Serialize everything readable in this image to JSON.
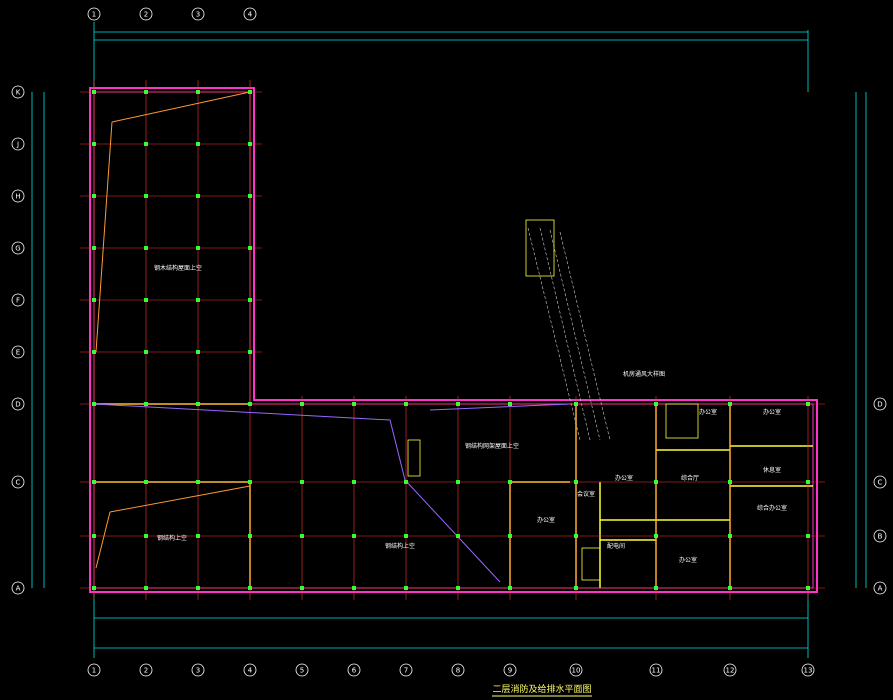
{
  "drawing": {
    "title": "二层消防及给排水平面图",
    "rooms": [
      {
        "key": "r1",
        "label": "钢木结构屋面上空"
      },
      {
        "key": "r2",
        "label": "钢结构上空"
      },
      {
        "key": "r3",
        "label": "钢结构上空"
      },
      {
        "key": "r4",
        "label": "钢结构网架屋面上空"
      },
      {
        "key": "r5",
        "label": "办公室"
      },
      {
        "key": "r6",
        "label": "会议室"
      },
      {
        "key": "r7",
        "label": "办公室"
      },
      {
        "key": "r8",
        "label": "综合厅"
      },
      {
        "key": "r9",
        "label": "办公室"
      },
      {
        "key": "r10",
        "label": "办公室"
      },
      {
        "key": "r11",
        "label": "办公室"
      },
      {
        "key": "r12",
        "label": "休息室"
      },
      {
        "key": "r13",
        "label": "综合办公室"
      },
      {
        "key": "r14",
        "label": "配电间"
      },
      {
        "key": "r15",
        "label": "机房通风大样图"
      }
    ],
    "axes_top": [
      "1",
      "2",
      "3",
      "4"
    ],
    "axes_bottom": [
      "1",
      "2",
      "3",
      "4",
      "5",
      "6",
      "7",
      "8",
      "9",
      "10",
      "11",
      "12",
      "13"
    ],
    "axes_left": [
      "K",
      "J",
      "H",
      "G",
      "F",
      "E",
      "D",
      "C",
      "A"
    ],
    "axes_right": [
      "D",
      "C",
      "B",
      "A"
    ]
  },
  "colors": {
    "background": "#000000",
    "wall": "#ff33cc",
    "axis": "#ff3333",
    "column": "#33ff33",
    "dim": "#00e5e5",
    "partition": "#ffff33",
    "pipe": "#9966ff",
    "text": "#ffffff"
  }
}
